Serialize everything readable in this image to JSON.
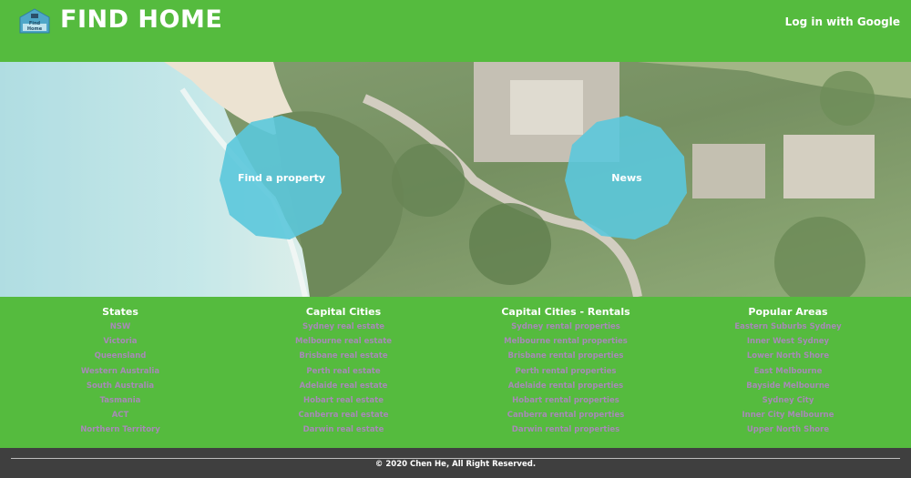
{
  "header": {
    "logo_text": "Find Home",
    "brand": "FIND HOME",
    "login_label": "Log in with Google"
  },
  "hero": {
    "actions": [
      {
        "label": "Find a property"
      },
      {
        "label": "News"
      }
    ]
  },
  "footer_links": {
    "columns": [
      {
        "title": "States",
        "items": [
          "NSW",
          "Victoria",
          "Queensland",
          "Western Australia",
          "South Australia",
          "Tasmania",
          "ACT",
          "Northern Territory"
        ]
      },
      {
        "title": "Capital Cities",
        "items": [
          "Sydney real estate",
          "Melbourne real estate",
          "Brisbane real estate",
          "Perth real estate",
          "Adelaide real estate",
          "Hobart real estate",
          "Canberra real estate",
          "Darwin real estate"
        ]
      },
      {
        "title": "Capital Cities - Rentals",
        "items": [
          "Sydney rental properties",
          "Melbourne rental properties",
          "Brisbane rental properties",
          "Perth rental properties",
          "Adelaide rental properties",
          "Hobart rental properties",
          "Canberra rental properties",
          "Darwin rental properties"
        ]
      },
      {
        "title": "Popular Areas",
        "items": [
          "Eastern Suburbs Sydney",
          "Inner West Sydney",
          "Lower North Shore",
          "East Melbourne",
          "Bayside Melbourne",
          "Sydney City",
          "Inner City Melbourne",
          "Upper North Shore"
        ]
      }
    ]
  },
  "footer": {
    "copyright": "© 2020 Chen He, All Right Reserved."
  },
  "colors": {
    "brand_green": "#55bb3e",
    "link_purple": "#a889b8",
    "polygon_cyan": "#5bc8dc",
    "footer_dark": "#3f3f3f"
  },
  "icons": {
    "logo": "house-icon"
  }
}
